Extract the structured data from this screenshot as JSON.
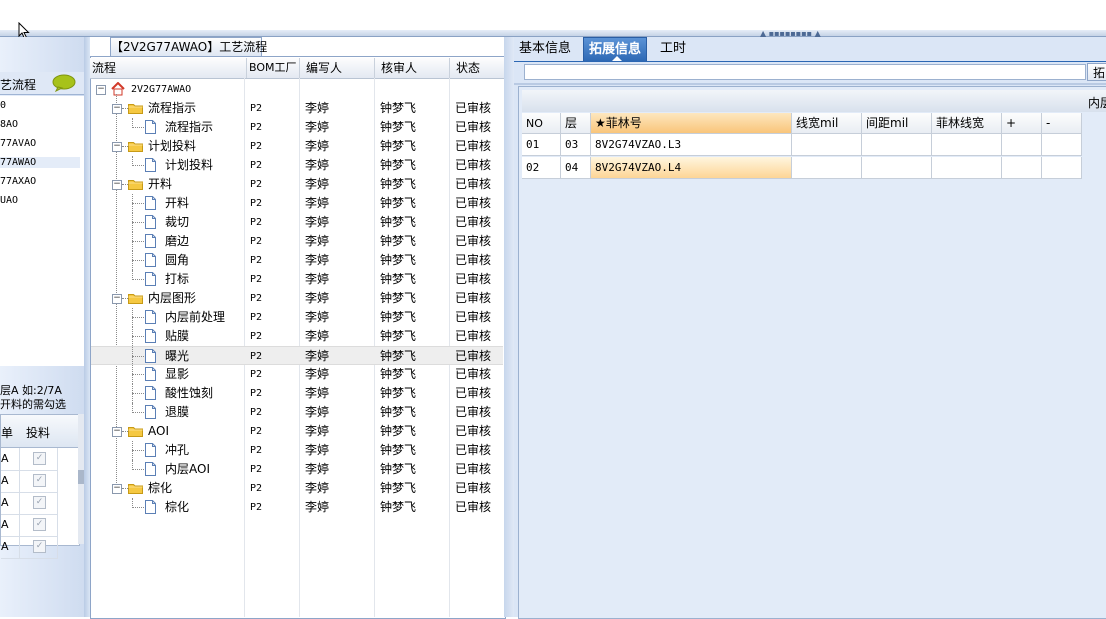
{
  "left": {
    "flow_title": "艺流程",
    "list_items": [
      "0",
      "8AO",
      "77AVAO",
      "77AWAO",
      "77AXAO",
      "UAO"
    ],
    "selected_index": 3,
    "note_line1": "层A 如:2/7A",
    "note_line2": "开料的需勾选",
    "grid_headers": [
      "单",
      "投料"
    ],
    "grid_rows": [
      "A",
      "A",
      "A",
      "A",
      "A"
    ],
    "check_mark": "✓"
  },
  "middle": {
    "tab_label": "【2V2G77AWAO】工艺流程",
    "headers": {
      "flow": "流程",
      "bom": "BOM工厂",
      "writer": "编写人",
      "reviewer": "核审人",
      "status": "状态"
    },
    "root_label": "2V2G77AWAO",
    "tree": [
      {
        "label": "流程指示",
        "level": 1,
        "bom": "P2",
        "writer": "李婷",
        "reviewer": "钟梦飞",
        "status": "已审核"
      },
      {
        "label": "流程指示",
        "level": 2,
        "bom": "P2",
        "writer": "李婷",
        "reviewer": "钟梦飞",
        "status": "已审核"
      },
      {
        "label": "计划投料",
        "level": 1,
        "bom": "P2",
        "writer": "李婷",
        "reviewer": "钟梦飞",
        "status": "已审核"
      },
      {
        "label": "计划投料",
        "level": 2,
        "bom": "P2",
        "writer": "李婷",
        "reviewer": "钟梦飞",
        "status": "已审核"
      },
      {
        "label": "开料",
        "level": 1,
        "bom": "P2",
        "writer": "李婷",
        "reviewer": "钟梦飞",
        "status": "已审核"
      },
      {
        "label": "开料",
        "level": 2,
        "bom": "P2",
        "writer": "李婷",
        "reviewer": "钟梦飞",
        "status": "已审核"
      },
      {
        "label": "裁切",
        "level": 2,
        "bom": "P2",
        "writer": "李婷",
        "reviewer": "钟梦飞",
        "status": "已审核"
      },
      {
        "label": "磨边",
        "level": 2,
        "bom": "P2",
        "writer": "李婷",
        "reviewer": "钟梦飞",
        "status": "已审核"
      },
      {
        "label": "圆角",
        "level": 2,
        "bom": "P2",
        "writer": "李婷",
        "reviewer": "钟梦飞",
        "status": "已审核"
      },
      {
        "label": "打标",
        "level": 2,
        "bom": "P2",
        "writer": "李婷",
        "reviewer": "钟梦飞",
        "status": "已审核"
      },
      {
        "label": "内层图形",
        "level": 1,
        "bom": "P2",
        "writer": "李婷",
        "reviewer": "钟梦飞",
        "status": "已审核"
      },
      {
        "label": "内层前处理",
        "level": 2,
        "bom": "P2",
        "writer": "李婷",
        "reviewer": "钟梦飞",
        "status": "已审核"
      },
      {
        "label": "贴膜",
        "level": 2,
        "bom": "P2",
        "writer": "李婷",
        "reviewer": "钟梦飞",
        "status": "已审核"
      },
      {
        "label": "曝光",
        "level": 2,
        "bom": "P2",
        "writer": "李婷",
        "reviewer": "钟梦飞",
        "status": "已审核"
      },
      {
        "label": "显影",
        "level": 2,
        "bom": "P2",
        "writer": "李婷",
        "reviewer": "钟梦飞",
        "status": "已审核"
      },
      {
        "label": "酸性蚀刻",
        "level": 2,
        "bom": "P2",
        "writer": "李婷",
        "reviewer": "钟梦飞",
        "status": "已审核"
      },
      {
        "label": "退膜",
        "level": 2,
        "bom": "P2",
        "writer": "李婷",
        "reviewer": "钟梦飞",
        "status": "已审核"
      },
      {
        "label": "AOI",
        "level": 1,
        "bom": "P2",
        "writer": "李婷",
        "reviewer": "钟梦飞",
        "status": "已审核"
      },
      {
        "label": "冲孔",
        "level": 2,
        "bom": "P2",
        "writer": "李婷",
        "reviewer": "钟梦飞",
        "status": "已审核"
      },
      {
        "label": "内层AOI",
        "level": 2,
        "bom": "P2",
        "writer": "李婷",
        "reviewer": "钟梦飞",
        "status": "已审核"
      },
      {
        "label": "棕化",
        "level": 1,
        "bom": "P2",
        "writer": "李婷",
        "reviewer": "钟梦飞",
        "status": "已审核"
      },
      {
        "label": "棕化",
        "level": 2,
        "bom": "P2",
        "writer": "李婷",
        "reviewer": "钟梦飞",
        "status": "已审核"
      }
    ],
    "selected_row": 13
  },
  "right": {
    "tabs": [
      "基本信息",
      "拓展信息",
      "工时"
    ],
    "active_tab": 1,
    "toolbar_button": "拓",
    "band_label": "内层",
    "grid_headers": [
      "NO",
      "层",
      "★菲林号",
      "线宽mil",
      "间距mil",
      "菲林线宽",
      "+",
      "-"
    ],
    "grid_rows": [
      {
        "no": "01",
        "layer": "03",
        "film": "8V2G74VZAO.L3"
      },
      {
        "no": "02",
        "layer": "04",
        "film": "8V2G74VZAO.L4"
      }
    ],
    "highlight_row": 1
  },
  "colors": {
    "active_tab": "#2c67b3",
    "panel_bg": "#dbe6f6",
    "key_header": "#f9c57a"
  }
}
